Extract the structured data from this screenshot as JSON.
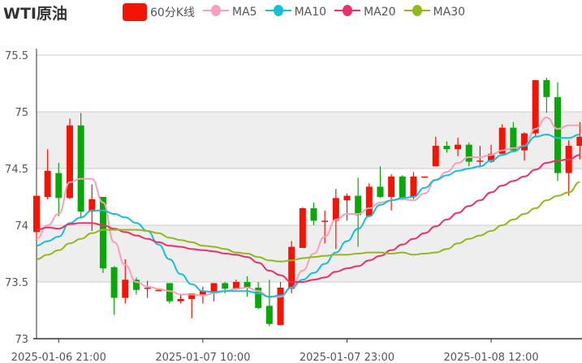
{
  "title": "WTI原油",
  "legend": [
    {
      "label": "60分K线",
      "color": "#f21505",
      "kind": "candle"
    },
    {
      "label": "MA5",
      "color": "#f9a0b9",
      "kind": "line"
    },
    {
      "label": "MA10",
      "color": "#16bfd8",
      "kind": "line"
    },
    {
      "label": "MA20",
      "color": "#ec2f6c",
      "kind": "line"
    },
    {
      "label": "MA30",
      "color": "#8fba1a",
      "kind": "line"
    }
  ],
  "chart_data": {
    "type": "candlestick",
    "up_color": "#f21505",
    "down_color": "#0aa70a",
    "ylim": [
      73,
      75.5
    ],
    "yticks": [
      "75.5",
      "75",
      "74.5",
      "74",
      "73.5",
      "73"
    ],
    "ytick_values": [
      75.5,
      75,
      74.5,
      74,
      73.5,
      73
    ],
    "xtick_labels": [
      {
        "label": "2025-01-06 21:00",
        "index": 2
      },
      {
        "label": "2025-01-07 10:00",
        "index": 15
      },
      {
        "label": "2025-01-07 23:00",
        "index": 28
      },
      {
        "label": "2025-01-08 12:00",
        "index": 41
      }
    ],
    "grid": "horizontal, alternating bands",
    "ohlc": [
      [
        73.94,
        74.26,
        74.27,
        73.87
      ],
      [
        74.25,
        74.48,
        74.67,
        74.23
      ],
      [
        74.46,
        74.24,
        74.55,
        74.08
      ],
      [
        74.24,
        74.88,
        74.94,
        74.23
      ],
      [
        74.88,
        74.12,
        74.99,
        74.06
      ],
      [
        74.12,
        74.23,
        74.36,
        73.95
      ],
      [
        74.25,
        73.62,
        74.25,
        73.58
      ],
      [
        73.63,
        73.36,
        73.64,
        73.21
      ],
      [
        73.36,
        73.52,
        73.7,
        73.31
      ],
      [
        73.52,
        73.43,
        73.54,
        73.39
      ],
      [
        73.44,
        73.45,
        73.51,
        73.36
      ],
      [
        73.43,
        73.43,
        73.44,
        73.42
      ],
      [
        73.49,
        73.33,
        73.49,
        73.31
      ],
      [
        73.33,
        73.35,
        73.39,
        73.31
      ],
      [
        73.35,
        73.4,
        73.4,
        73.18
      ],
      [
        73.39,
        73.42,
        73.46,
        73.31
      ],
      [
        73.41,
        73.49,
        73.49,
        73.33
      ],
      [
        73.49,
        73.44,
        73.5,
        73.4
      ],
      [
        73.44,
        73.5,
        73.52,
        73.43
      ],
      [
        73.5,
        73.45,
        73.55,
        73.37
      ],
      [
        73.45,
        73.27,
        73.5,
        73.26
      ],
      [
        73.29,
        73.13,
        73.52,
        73.11
      ],
      [
        73.12,
        73.45,
        73.5,
        73.12
      ],
      [
        73.44,
        73.81,
        73.86,
        73.4
      ],
      [
        73.8,
        74.15,
        74.16,
        73.8
      ],
      [
        74.15,
        74.04,
        74.2,
        74.0
      ],
      [
        74.03,
        74.04,
        74.13,
        73.84
      ],
      [
        74.04,
        74.24,
        74.32,
        73.79
      ],
      [
        74.22,
        74.26,
        74.28,
        74.04
      ],
      [
        74.26,
        74.09,
        74.42,
        73.81
      ],
      [
        74.08,
        74.34,
        74.37,
        74.07
      ],
      [
        74.34,
        74.25,
        74.52,
        74.24
      ],
      [
        74.25,
        74.43,
        74.45,
        74.13
      ],
      [
        74.43,
        74.24,
        74.44,
        74.22
      ],
      [
        74.25,
        74.43,
        74.47,
        74.23
      ],
      [
        74.42,
        74.43,
        74.43,
        74.42
      ],
      [
        74.52,
        74.7,
        74.78,
        74.52
      ],
      [
        74.7,
        74.67,
        74.74,
        74.64
      ],
      [
        74.67,
        74.71,
        74.77,
        74.61
      ],
      [
        74.71,
        74.56,
        74.73,
        74.52
      ],
      [
        74.56,
        74.57,
        74.7,
        74.51
      ],
      [
        74.56,
        74.63,
        74.71,
        74.55
      ],
      [
        74.63,
        74.86,
        74.89,
        74.63
      ],
      [
        74.86,
        74.66,
        74.91,
        74.65
      ],
      [
        74.66,
        74.81,
        74.82,
        74.57
      ],
      [
        74.81,
        75.28,
        75.28,
        74.78
      ],
      [
        75.28,
        75.13,
        75.3,
        74.99
      ],
      [
        75.13,
        74.46,
        75.26,
        74.39
      ],
      [
        74.46,
        74.7,
        74.75,
        74.26
      ],
      [
        74.7,
        74.78,
        74.91,
        74.58
      ]
    ],
    "series": [
      {
        "name": "MA5",
        "values": [
          73.88,
          74.0,
          74.1,
          74.38,
          74.41,
          74.41,
          74.2,
          73.85,
          73.65,
          73.5,
          73.46,
          73.44,
          73.42,
          73.39,
          73.39,
          73.38,
          73.4,
          73.42,
          73.44,
          73.45,
          73.42,
          73.37,
          73.37,
          73.45,
          73.6,
          73.75,
          73.9,
          74.05,
          74.1,
          74.1,
          74.15,
          74.2,
          74.22,
          74.23,
          74.22,
          74.28,
          74.4,
          74.47,
          74.55,
          74.6,
          74.6,
          74.62,
          74.66,
          74.68,
          74.7,
          74.85,
          74.95,
          74.85,
          74.88,
          74.88
        ]
      },
      {
        "name": "MA10",
        "values": [
          73.82,
          73.86,
          73.9,
          74.02,
          74.07,
          74.13,
          74.13,
          74.1,
          74.07,
          74.02,
          73.95,
          73.83,
          73.7,
          73.57,
          73.48,
          73.42,
          73.41,
          73.42,
          73.42,
          73.42,
          73.4,
          73.37,
          73.38,
          73.45,
          73.52,
          73.58,
          73.66,
          73.76,
          73.86,
          73.97,
          74.08,
          74.18,
          74.22,
          74.24,
          74.25,
          74.33,
          74.4,
          74.44,
          74.48,
          74.5,
          74.52,
          74.57,
          74.62,
          74.65,
          74.7,
          74.78,
          74.8,
          74.77,
          74.77,
          74.8
        ]
      },
      {
        "name": "MA20",
        "values": [
          73.96,
          73.98,
          73.97,
          74.01,
          74.02,
          74.02,
          74.0,
          73.97,
          73.94,
          73.91,
          73.88,
          73.85,
          73.82,
          73.81,
          73.79,
          73.78,
          73.77,
          73.75,
          73.74,
          73.72,
          73.67,
          73.6,
          73.56,
          73.5,
          73.5,
          73.52,
          73.54,
          73.59,
          73.62,
          73.64,
          73.69,
          73.73,
          73.78,
          73.83,
          73.88,
          73.93,
          73.99,
          74.05,
          74.11,
          74.17,
          74.22,
          74.29,
          74.35,
          74.39,
          74.43,
          74.49,
          74.55,
          74.57,
          74.58,
          74.62
        ]
      },
      {
        "name": "MA30",
        "values": [
          73.7,
          73.74,
          73.78,
          73.84,
          73.88,
          73.93,
          73.96,
          73.96,
          73.96,
          73.96,
          73.95,
          73.93,
          73.89,
          73.87,
          73.85,
          73.82,
          73.81,
          73.79,
          73.76,
          73.75,
          73.72,
          73.69,
          73.68,
          73.69,
          73.71,
          73.72,
          73.73,
          73.74,
          73.74,
          73.75,
          73.76,
          73.76,
          73.75,
          73.76,
          73.74,
          73.75,
          73.76,
          73.79,
          73.84,
          73.88,
          73.91,
          73.95,
          74.0,
          74.05,
          74.1,
          74.15,
          74.22,
          74.26,
          74.29,
          74.38
        ]
      }
    ]
  }
}
